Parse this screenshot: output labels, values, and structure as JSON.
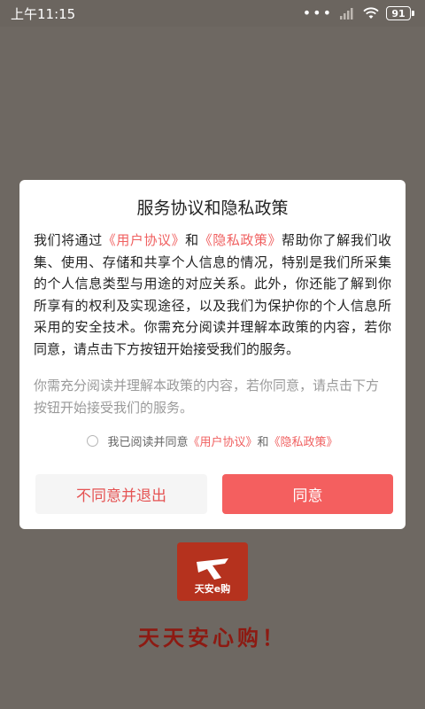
{
  "status_bar": {
    "time": "上午11:15",
    "dots": "•••",
    "battery": "91"
  },
  "dialog": {
    "title": "服务协议和隐私政策",
    "body_pre": "我们将通过",
    "link_user_agreement": "《用户协议》",
    "body_and": "和",
    "link_privacy_policy": "《隐私政策》",
    "body_post": "帮助你了解我们收集、使用、存储和共享个人信息的情况，特别是我们所采集的个人信息类型与用途的对应关系。此外，你还能了解到你所享有的权利及实现途径，以及我们为保护你的个人信息所采用的安全技术。你需充分阅读并理解本政策的内容，若你同意，请点击下方按钮开始接受我们的服务。",
    "sub_text": "你需充分阅读并理解本政策的内容，若你同意，请点击下方按钮开始接受我们的服务。",
    "checkbox_label_pre": "我已阅读并同意",
    "checkbox_link_user_agreement": "《用户协议》",
    "checkbox_and": "和",
    "checkbox_link_privacy_policy": "《隐私政策》",
    "disagree_button": "不同意并退出",
    "agree_button": "同意"
  },
  "splash": {
    "logo_text": "天安e购",
    "slogan": "天天安心购！"
  },
  "colors": {
    "accent": "#f45f5f",
    "link": "#f06060",
    "overlay": "#6e6862",
    "brand": "#b5321e"
  }
}
